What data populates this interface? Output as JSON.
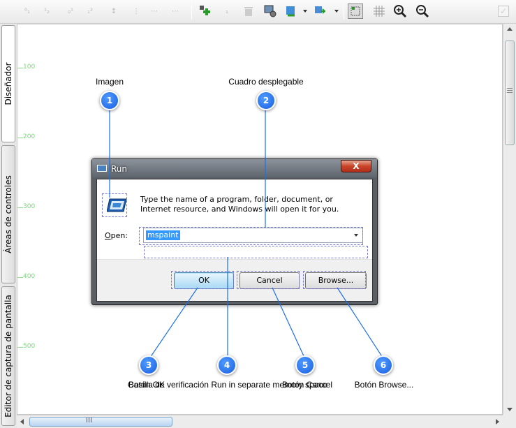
{
  "toolbar": {
    "buttons": [
      {
        "icon": "align-bottom-left-icon"
      },
      {
        "icon": "align-bottom-right-icon"
      },
      {
        "icon": "align-top-left-icon"
      },
      {
        "icon": "align-top-right-icon"
      },
      {
        "icon": "renumber-icon"
      },
      {
        "icon": "distribute-vertical-icon"
      },
      {
        "icon": "distribute-horizontal-icon"
      },
      {
        "icon": "add-callout-icon"
      },
      {
        "icon": "add-numbered-icon"
      },
      {
        "icon": "delete-callout-icon"
      },
      {
        "icon": "settings-capture-icon"
      },
      {
        "icon": "refresh-icon"
      },
      {
        "icon": "export-icon"
      },
      {
        "icon": "select-mode-icon"
      },
      {
        "icon": "grid-icon"
      },
      {
        "icon": "zoom-in-icon"
      },
      {
        "icon": "zoom-out-icon"
      }
    ]
  },
  "side_tabs": [
    {
      "label": "Diseñador"
    },
    {
      "label": "Áreas de controles"
    },
    {
      "label": "Editor de captura de pantalla"
    }
  ],
  "ruler": {
    "labels": [
      "100",
      "200",
      "300",
      "400",
      "500"
    ]
  },
  "dialog": {
    "title": "Run",
    "close_glyph": "X",
    "description": "Type the name of a program, folder, document, or Internet resource, and Windows will open it for you.",
    "open_label": "Open:",
    "open_value": "mspaint",
    "ok_label": "OK",
    "cancel_label": "Cancel",
    "browse_label": "Browse..."
  },
  "callouts": [
    {
      "number": "1",
      "label": "Imagen"
    },
    {
      "number": "2",
      "label": "Cuadro desplegable"
    },
    {
      "number": "3",
      "label": "Botón OK"
    },
    {
      "number": "4",
      "label": "Casilla de verificación Run in separate memory space"
    },
    {
      "number": "5",
      "label": "Botón Cancel"
    },
    {
      "number": "6",
      "label": "Botón Browse..."
    }
  ],
  "colors": {
    "marker": "#1f66e5",
    "leader": "#1e6ee8",
    "ruler": "#8fe08f"
  }
}
